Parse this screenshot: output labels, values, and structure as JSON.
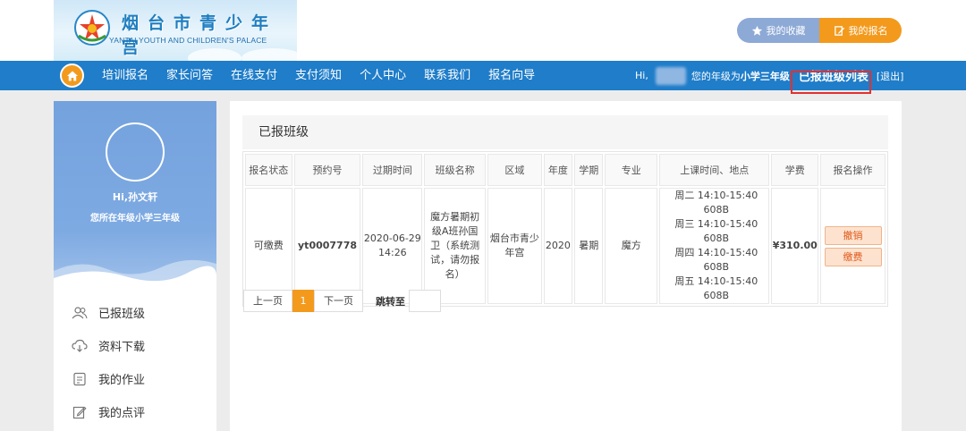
{
  "header": {
    "logo_cn": "烟台市青少年宫",
    "logo_en": "YANTAI YOUTH AND CHILDREN'S PALACE",
    "favorites_label": "我的收藏",
    "my_registration_label": "我的报名"
  },
  "nav": {
    "items": [
      "培训报名",
      "家长问答",
      "在线支付",
      "支付须知",
      "个人中心",
      "联系我们",
      "报名向导"
    ],
    "greeting": "Hi,",
    "grade_prefix": "您的年级为",
    "grade": "小学三年级",
    "registered_list_link": "已报班级列表",
    "logout": "[退出]"
  },
  "sidebar": {
    "hi_name": "Hi,孙文轩",
    "grade_line": "您所在年级小学三年级",
    "menu": [
      {
        "label": "已报班级",
        "icon": "users-icon"
      },
      {
        "label": "资料下载",
        "icon": "cloud-download-icon"
      },
      {
        "label": "我的作业",
        "icon": "homework-icon"
      },
      {
        "label": "我的点评",
        "icon": "edit-icon"
      }
    ]
  },
  "main": {
    "title": "已报班级",
    "columns": [
      "报名状态",
      "预约号",
      "过期时间",
      "班级名称",
      "区域",
      "年度",
      "学期",
      "专业",
      "上课时间、地点",
      "学费",
      "报名操作"
    ],
    "rows": [
      {
        "status": "可缴费",
        "reservation_no": "yt0007778",
        "expire_date": "2020-06-29",
        "expire_time": "14:26",
        "class_name": "魔方暑期初级A班孙国卫（系统测试，请勿报名）",
        "area": "烟台市青少年宫",
        "year": "2020",
        "term": "暑期",
        "major": "魔方",
        "schedule": [
          "周二 14:10-15:40 608B",
          "周三 14:10-15:40 608B",
          "周四 14:10-15:40 608B",
          "周五 14:10-15:40 608B"
        ],
        "fee": "¥310.00",
        "cancel_label": "撤销",
        "pay_label": "缴费"
      }
    ]
  },
  "pager": {
    "prev": "上一页",
    "current": "1",
    "next": "下一页",
    "jump_label": "跳转至"
  },
  "colors": {
    "nav_blue": "#1f7dc9",
    "accent_orange": "#f39a1d",
    "highlight_red": "#e3302f",
    "sidebar_blue": "#7eaae2"
  }
}
